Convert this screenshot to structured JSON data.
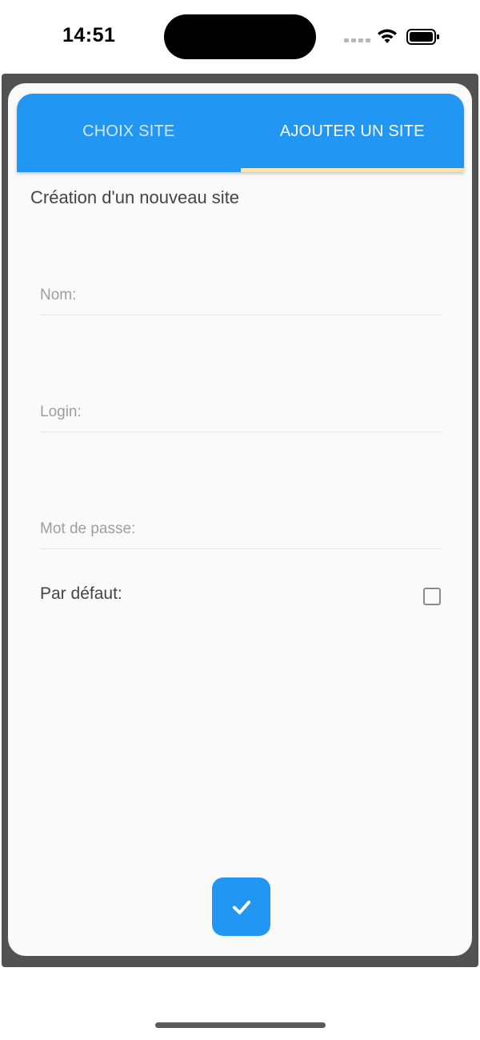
{
  "status_bar": {
    "time": "14:51"
  },
  "tabs": [
    {
      "label": "CHOIX SITE",
      "active": false
    },
    {
      "label": "AJOUTER UN SITE",
      "active": true
    }
  ],
  "form": {
    "heading": "Création d'un nouveau site",
    "name_field": {
      "placeholder": "Nom:",
      "value": ""
    },
    "login_field": {
      "placeholder": "Login:",
      "value": ""
    },
    "password_field": {
      "placeholder": "Mot de passe:",
      "value": ""
    },
    "default_label": "Par défaut:",
    "default_checked": false
  },
  "submit": {
    "icon": "check-icon"
  },
  "colors": {
    "primary": "#2196f3",
    "tab_indicator": "#fde3b0",
    "inactive_tab_text": "#d3e9fd",
    "background_overlay": "#525252"
  }
}
